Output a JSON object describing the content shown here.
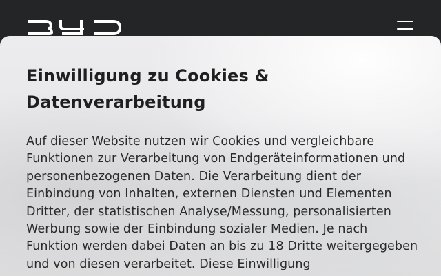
{
  "header": {
    "logo": "BYD",
    "menu_icon": "hamburger-menu-icon"
  },
  "cookie_modal": {
    "title": "Einwilligung zu Cookies & Datenverarbeitung",
    "text": "Auf dieser Website nutzen wir Cookies und vergleichbare Funktionen zur Verarbeitung von Endgeräteinformationen und personenbezogenen Daten. Die Verarbeitung dient der Einbindung von Inhalten, externen Diensten und Elementen Dritter, der statistischen Analyse/Messung, personalisierten Werbung sowie der Einbindung sozialer Medien. Je nach Funktion werden dabei Daten an bis zu 18 Dritte weitergegeben und von diesen verarbeitet. Diese Einwilligung"
  },
  "colors": {
    "header_bg": "#242527",
    "modal_bg": "#e8e8ea",
    "title_text": "#1f1f1f",
    "body_text": "#2a2a2a",
    "icon": "#ffffff"
  }
}
